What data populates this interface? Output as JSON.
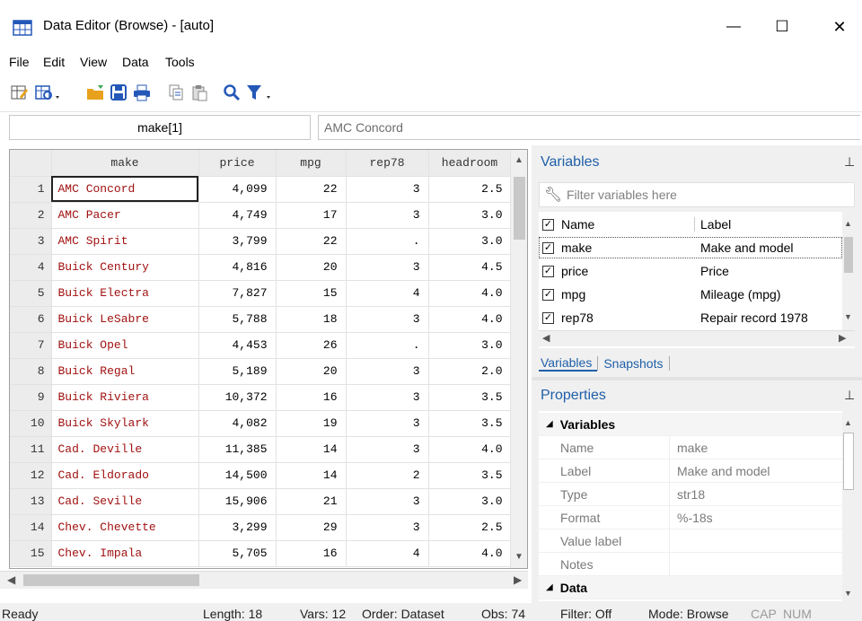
{
  "window": {
    "title": "Data Editor (Browse) - [auto]",
    "minimize_glyph": "—",
    "maximize_glyph": "☐",
    "close_glyph": "✕"
  },
  "menu": [
    "File",
    "Edit",
    "View",
    "Data",
    "Tools"
  ],
  "cellbar": {
    "cell_name": "make[1]",
    "cell_value": "AMC Concord"
  },
  "grid": {
    "columns": [
      "make",
      "price",
      "mpg",
      "rep78",
      "headroom"
    ],
    "rows": [
      {
        "n": "1",
        "make": "AMC Concord",
        "price": "4,099",
        "mpg": "22",
        "rep78": "3",
        "headroom": "2.5"
      },
      {
        "n": "2",
        "make": "AMC Pacer",
        "price": "4,749",
        "mpg": "17",
        "rep78": "3",
        "headroom": "3.0"
      },
      {
        "n": "3",
        "make": "AMC Spirit",
        "price": "3,799",
        "mpg": "22",
        "rep78": ".",
        "headroom": "3.0"
      },
      {
        "n": "4",
        "make": "Buick Century",
        "price": "4,816",
        "mpg": "20",
        "rep78": "3",
        "headroom": "4.5"
      },
      {
        "n": "5",
        "make": "Buick Electra",
        "price": "7,827",
        "mpg": "15",
        "rep78": "4",
        "headroom": "4.0"
      },
      {
        "n": "6",
        "make": "Buick LeSabre",
        "price": "5,788",
        "mpg": "18",
        "rep78": "3",
        "headroom": "4.0"
      },
      {
        "n": "7",
        "make": "Buick Opel",
        "price": "4,453",
        "mpg": "26",
        "rep78": ".",
        "headroom": "3.0"
      },
      {
        "n": "8",
        "make": "Buick Regal",
        "price": "5,189",
        "mpg": "20",
        "rep78": "3",
        "headroom": "2.0"
      },
      {
        "n": "9",
        "make": "Buick Riviera",
        "price": "10,372",
        "mpg": "16",
        "rep78": "3",
        "headroom": "3.5"
      },
      {
        "n": "10",
        "make": "Buick Skylark",
        "price": "4,082",
        "mpg": "19",
        "rep78": "3",
        "headroom": "3.5"
      },
      {
        "n": "11",
        "make": "Cad. Deville",
        "price": "11,385",
        "mpg": "14",
        "rep78": "3",
        "headroom": "4.0"
      },
      {
        "n": "12",
        "make": "Cad. Eldorado",
        "price": "14,500",
        "mpg": "14",
        "rep78": "2",
        "headroom": "3.5"
      },
      {
        "n": "13",
        "make": "Cad. Seville",
        "price": "15,906",
        "mpg": "21",
        "rep78": "3",
        "headroom": "3.0"
      },
      {
        "n": "14",
        "make": "Chev. Chevette",
        "price": "3,299",
        "mpg": "29",
        "rep78": "3",
        "headroom": "2.5"
      },
      {
        "n": "15",
        "make": "Chev. Impala",
        "price": "5,705",
        "mpg": "16",
        "rep78": "4",
        "headroom": "4.0"
      }
    ]
  },
  "variables_panel": {
    "title": "Variables",
    "filter_placeholder": "Filter variables here",
    "header_name": "Name",
    "header_label": "Label",
    "items": [
      {
        "name": "make",
        "label": "Make and model"
      },
      {
        "name": "price",
        "label": "Price"
      },
      {
        "name": "mpg",
        "label": "Mileage (mpg)"
      },
      {
        "name": "rep78",
        "label": "Repair record 1978"
      }
    ],
    "tabs": [
      "Variables",
      "Snapshots"
    ]
  },
  "properties_panel": {
    "title": "Properties",
    "section_variables": "Variables",
    "section_data": "Data",
    "rows": [
      {
        "key": "Name",
        "value": "make"
      },
      {
        "key": "Label",
        "value": "Make and model"
      },
      {
        "key": "Type",
        "value": "str18"
      },
      {
        "key": "Format",
        "value": "%-18s"
      },
      {
        "key": "Value label",
        "value": ""
      },
      {
        "key": "Notes",
        "value": ""
      }
    ]
  },
  "status": {
    "ready": "Ready",
    "length": "Length: 18",
    "vars": "Vars: 12",
    "order": "Order: Dataset",
    "obs": "Obs: 74",
    "filter": "Filter: Off",
    "mode": "Mode: Browse",
    "cap": "CAP",
    "num": "NUM"
  },
  "colors": {
    "accent": "#1f5fa8",
    "string_text": "#a11111",
    "toolbar_gold": "#e8a11c",
    "toolbar_blue": "#2458b8"
  }
}
